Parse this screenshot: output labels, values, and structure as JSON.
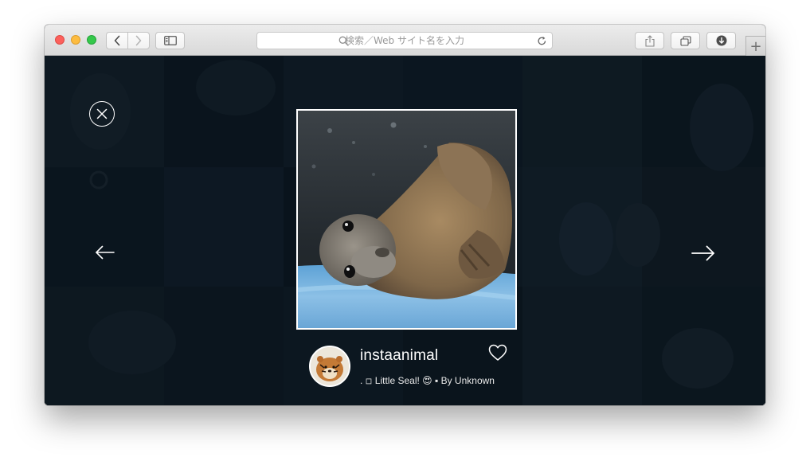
{
  "browser": {
    "window_controls": [
      "close",
      "minimize",
      "zoom"
    ],
    "toolbar_icons": {
      "back": "chevron-left-icon",
      "forward": "chevron-right-icon",
      "sidebar": "sidebar-icon",
      "share": "share-icon",
      "tabs": "tab-overview-icon",
      "downloads": "download-icon",
      "new_tab": "plus-icon"
    },
    "address_bar": {
      "placeholder": "検索／Web サイト名を入力",
      "value": ""
    },
    "new_tab_label": "+"
  },
  "viewer": {
    "close_icon": "close-circle-icon",
    "prev_icon": "arrow-left-icon",
    "next_icon": "arrow-right-icon",
    "photo_alt": "seal-photo",
    "post": {
      "username": "instaanimal",
      "caption": ". ◽ Little Seal! 😍 ▪ By Unknown",
      "like_icon": "heart-outline-icon"
    }
  },
  "colors": {
    "overlay_bg": "#0b1520",
    "close_red": "#fc605c",
    "minimize_yellow": "#fdbc40",
    "zoom_green": "#34c84a"
  }
}
